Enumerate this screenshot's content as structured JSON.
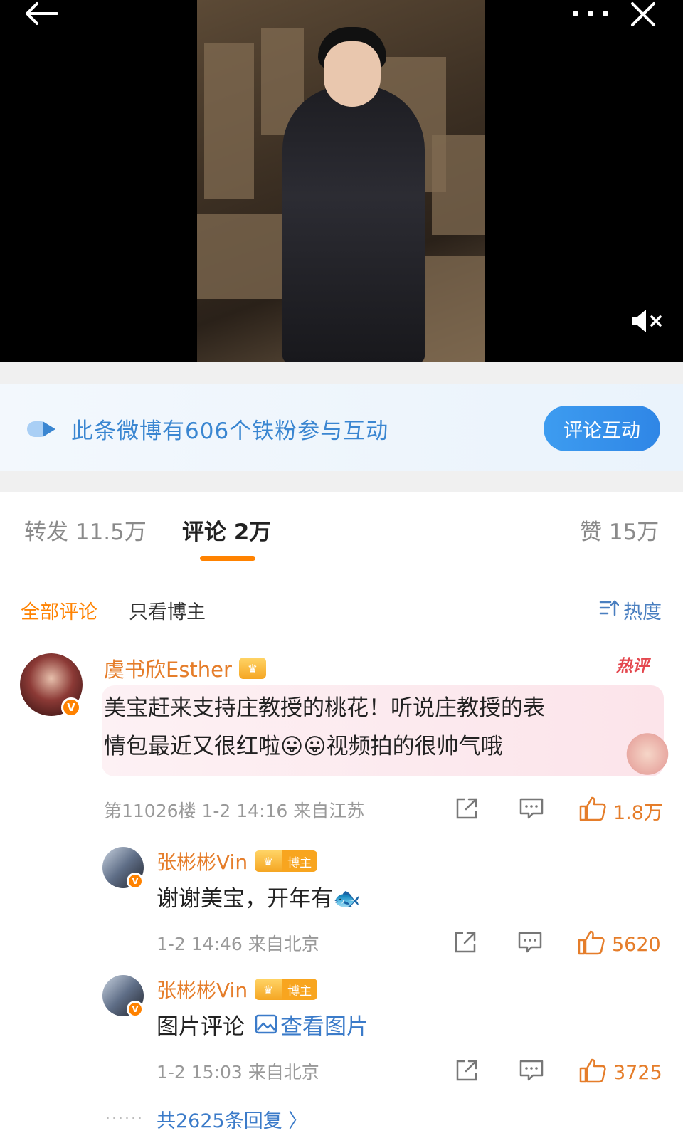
{
  "video": {
    "mute_icon": "speaker-muted-icon",
    "back_icon": "back-arrow-icon",
    "more_icon": "more-dots-icon",
    "close_icon": "close-icon"
  },
  "banner": {
    "text": "此条微博有606个铁粉参与互动",
    "button": "评论互动",
    "accent": "#3a86d1"
  },
  "tabs": [
    {
      "label": "转发 11.5万"
    },
    {
      "label": "评论 2万"
    },
    {
      "label": "赞 15万"
    }
  ],
  "filters": {
    "all": "全部评论",
    "host_only": "只看博主",
    "sort": "热度"
  },
  "comment": {
    "user": "虞书欣Esther",
    "badge": "热评",
    "text_line1": "美宝赶来支持庄教授的桃花！听说庄教授的表",
    "text_line2": "情包最近又很红啦😛😛视频拍的很帅气哦",
    "meta": "第11026楼 1-2 14:16 来自江苏",
    "likes": "1.8万"
  },
  "replies": [
    {
      "user": "张彬彬Vin",
      "host_tag": "博主",
      "text": "谢谢美宝，开年有🐟",
      "meta": "1-2 14:46 来自北京",
      "likes": "5620"
    },
    {
      "user": "张彬彬Vin",
      "host_tag": "博主",
      "text": "图片评论",
      "link": "查看图片",
      "meta": "1-2 15:03 来自北京",
      "likes": "3725"
    }
  ],
  "more_replies": "共2625条回复 〉",
  "colors": {
    "orange": "#ff8200",
    "blue": "#3a86d1",
    "hot_red": "#e4474e"
  }
}
